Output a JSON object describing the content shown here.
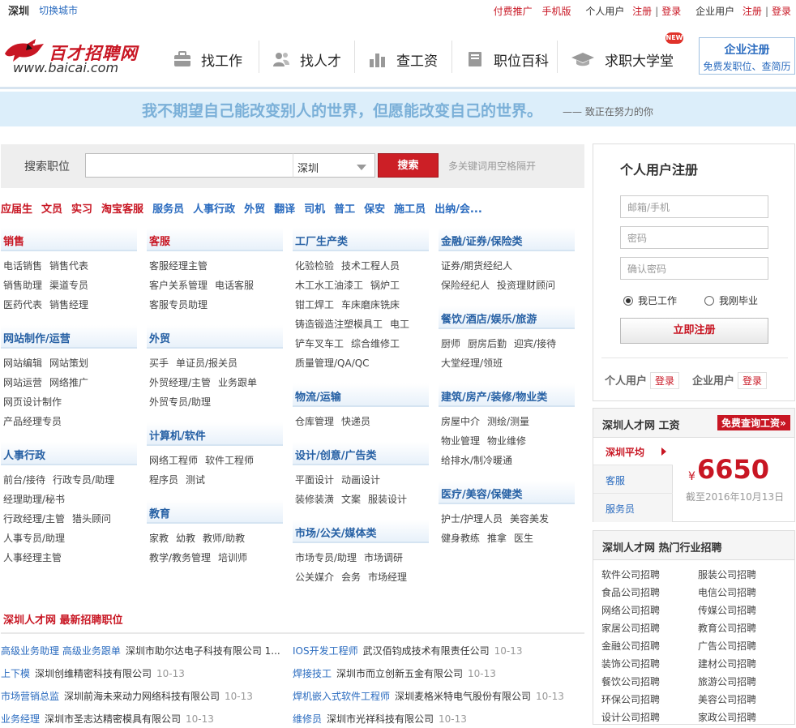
{
  "topbar": {
    "city": "深圳",
    "switch_city": "切换城市",
    "paid_promo": "付费推广",
    "mobile": "手机版",
    "personal_user": "个人用户",
    "register": "注册",
    "login": "登录",
    "corp_user": "企业用户",
    "corp_register": "注册",
    "corp_login": "登录"
  },
  "logo": {
    "title": "百才招聘网",
    "url": "www.baicai.com"
  },
  "nav": [
    {
      "label": "找工作",
      "icon": "briefcase-icon"
    },
    {
      "label": "找人才",
      "icon": "people-icon"
    },
    {
      "label": "查工资",
      "icon": "bar-chart-icon"
    },
    {
      "label": "职位百科",
      "icon": "book-icon"
    },
    {
      "label": "求职大学堂",
      "icon": "graduation-cap-icon"
    }
  ],
  "new_badge": "NEW",
  "corp_reg": {
    "title": "企业注册",
    "subtitle": "免费发职位、查简历"
  },
  "slogan": {
    "main": "我不期望自己能改变别人的世界，但愿能改变自己的世界。",
    "sub": "—— 致正在努力的你"
  },
  "search": {
    "label": "搜索职位",
    "placeholder": "",
    "city": "深圳",
    "button": "搜索",
    "hint": "多关键词用空格隔开"
  },
  "hotwords": [
    {
      "text": "应届生",
      "color": "#c81623"
    },
    {
      "text": "文员",
      "color": "#c81623"
    },
    {
      "text": "实习",
      "color": "#c81623"
    },
    {
      "text": "淘宝客服",
      "color": "#c81623"
    },
    {
      "text": "服务员",
      "color": "#2a6bbf"
    },
    {
      "text": "人事行政",
      "color": "#2a6bbf"
    },
    {
      "text": "外贸",
      "color": "#2a6bbf"
    },
    {
      "text": "翻译",
      "color": "#2a6bbf"
    },
    {
      "text": "司机",
      "color": "#2a6bbf"
    },
    {
      "text": "普工",
      "color": "#2a6bbf"
    },
    {
      "text": "保安",
      "color": "#2a6bbf"
    },
    {
      "text": "施工员",
      "color": "#2a6bbf"
    },
    {
      "text": "出纳/会...",
      "color": "#2a6bbf"
    }
  ],
  "categories": [
    {
      "title": "销售",
      "red": true,
      "lines": [
        [
          "电话销售",
          "销售代表"
        ],
        [
          "销售助理",
          "渠道专员"
        ],
        [
          "医药代表",
          "销售经理"
        ]
      ]
    },
    {
      "title": "网站制作/运营",
      "red": false,
      "lines": [
        [
          "网站编辑",
          "网站策划"
        ],
        [
          "网站运营",
          "网络推广"
        ],
        [
          "网页设计制作"
        ],
        [
          "产品经理专员"
        ]
      ]
    },
    {
      "title": "人事行政",
      "red": false,
      "lines": [
        [
          "前台/接待",
          "行政专员/助理"
        ],
        [
          "经理助理/秘书"
        ],
        [
          "行政经理/主管",
          "猎头顾问"
        ],
        [
          "人事专员/助理"
        ],
        [
          "人事经理主管"
        ]
      ]
    },
    {
      "title": "客服",
      "red": true,
      "lines": [
        [
          "客服经理主管"
        ],
        [
          "客户关系管理",
          "电话客服"
        ],
        [
          "客服专员助理"
        ]
      ]
    },
    {
      "title": "外贸",
      "red": false,
      "lines": [
        [
          "买手",
          "单证员/报关员"
        ],
        [
          "外贸经理/主管",
          "业务跟单"
        ],
        [
          "外贸专员/助理"
        ]
      ]
    },
    {
      "title": "计算机/软件",
      "red": false,
      "lines": [
        [
          "网络工程师",
          "软件工程师"
        ],
        [
          "程序员",
          "测试"
        ]
      ]
    },
    {
      "title": "教育",
      "red": false,
      "lines": [
        [
          "家教",
          "幼教",
          "教师/助教"
        ],
        [
          "教学/教务管理",
          "培训师"
        ]
      ]
    },
    {
      "title": "工厂生产类",
      "red": false,
      "lines": [
        [
          "化验检验",
          "技术工程人员"
        ],
        [
          "木工水工油漆工",
          "锅炉工"
        ],
        [
          "钳工焊工",
          "车床磨床铣床"
        ],
        [
          "铸造锻造注塑模具工",
          "电工"
        ],
        [
          "铲车叉车工",
          "综合维修工"
        ],
        [
          "质量管理/QA/QC"
        ]
      ]
    },
    {
      "title": "物流/运输",
      "red": false,
      "lines": [
        [
          "仓库管理",
          "快递员"
        ]
      ]
    },
    {
      "title": "设计/创意/广告类",
      "red": false,
      "lines": [
        [
          "平面设计",
          "动画设计"
        ],
        [
          "装修装潢",
          "文案",
          "服装设计"
        ]
      ]
    },
    {
      "title": "市场/公关/媒体类",
      "red": false,
      "lines": [
        [
          "市场专员/助理",
          "市场调研"
        ],
        [
          "公关媒介",
          "会务",
          "市场经理"
        ]
      ]
    },
    {
      "title": "金融/证券/保险类",
      "red": false,
      "lines": [
        [
          "证券/期货经纪人"
        ],
        [
          "保险经纪人",
          "投资理财顾问"
        ]
      ]
    },
    {
      "title": "餐饮/酒店/娱乐/旅游",
      "red": false,
      "lines": [
        [
          "厨师",
          "厨房后勤",
          "迎宾/接待"
        ],
        [
          "大堂经理/领班"
        ]
      ]
    },
    {
      "title": "建筑/房产/装修/物业类",
      "red": false,
      "lines": [
        [
          "房屋中介",
          "测绘/测量"
        ],
        [
          "物业管理",
          "物业维修"
        ],
        [
          "给排水/制冷暖通"
        ]
      ]
    },
    {
      "title": "医疗/美容/保健类",
      "red": false,
      "lines": [
        [
          "护士/护理人员",
          "美容美发"
        ],
        [
          "健身教练",
          "推拿",
          "医生"
        ]
      ]
    }
  ],
  "latest": {
    "title": "深圳人才网 最新招聘职位",
    "jobs": [
      {
        "title": "高级业务助理 高级业务跟单",
        "company": "深圳市助尔达电子科技有限公司 1...",
        "date": ""
      },
      {
        "title": "IOS开发工程师",
        "company": "武汉佰钧成技术有限责任公司",
        "date": "10-13"
      },
      {
        "title": "上下模",
        "company": "深圳创维精密科技有限公司",
        "date": "10-13"
      },
      {
        "title": "焊接技工",
        "company": "深圳市而立创新五金有限公司",
        "date": "10-13"
      },
      {
        "title": "市场营销总监",
        "company": "深圳前海未来动力网络科技有限公司",
        "date": "10-13"
      },
      {
        "title": "焊机嵌入式软件工程师",
        "company": "深圳麦格米特电气股份有限公司",
        "date": "10-13"
      },
      {
        "title": "业务经理",
        "company": "深圳市圣志达精密模具有限公司",
        "date": "10-13"
      },
      {
        "title": "维修员",
        "company": "深圳市光祥科技有限公司",
        "date": "10-13"
      }
    ]
  },
  "register_panel": {
    "title": "个人用户注册",
    "email_placeholder": "邮箱/手机",
    "password_placeholder": "密码",
    "confirm_placeholder": "确认密码",
    "radio_working": "我已工作",
    "radio_graduate": "我刚毕业",
    "submit": "立即注册",
    "personal_user": "个人用户",
    "corp_user": "企业用户",
    "login": "登录"
  },
  "salary": {
    "title": "深圳人才网 工资",
    "badge": "免费查询工资»",
    "tabs": [
      "深圳平均",
      "客服",
      "服务员"
    ],
    "currency": "¥",
    "value": "6650",
    "date": "截至2016年10月13日"
  },
  "hot_industry": {
    "title": "深圳人才网 热门行业招聘",
    "left": [
      "软件公司招聘",
      "食品公司招聘",
      "网络公司招聘",
      "家居公司招聘",
      "金融公司招聘",
      "装饰公司招聘",
      "餐饮公司招聘",
      "环保公司招聘",
      "设计公司招聘"
    ],
    "right": [
      "服装公司招聘",
      "电信公司招聘",
      "传媒公司招聘",
      "教育公司招聘",
      "广告公司招聘",
      "建材公司招聘",
      "旅游公司招聘",
      "美容公司招聘",
      "家政公司招聘"
    ]
  }
}
